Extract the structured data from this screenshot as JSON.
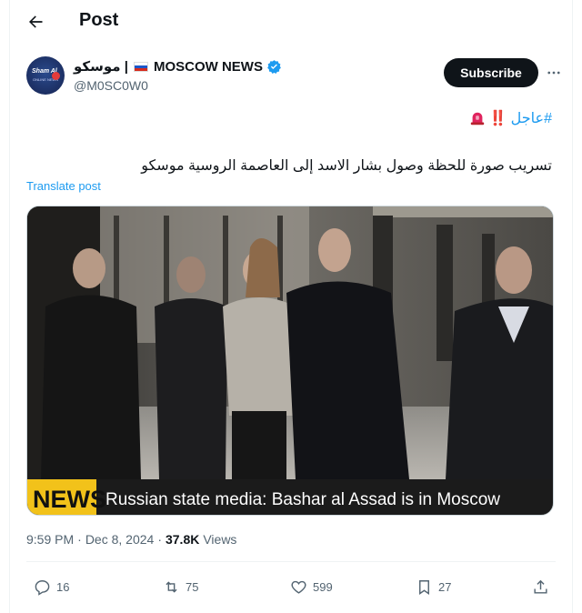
{
  "topbar": {
    "title": "Post"
  },
  "author": {
    "name_arabic": "موسكو |",
    "name_english": "MOSCOW NEWS",
    "handle": "@M0SC0W0",
    "avatar_text": "Sham Al",
    "avatar_sub": "ONLINE NEWS",
    "subscribe_label": "Subscribe"
  },
  "post": {
    "hashtag": "#عاجل",
    "bangs": "‼️",
    "text": "تسريب صورة للحظة وصول بشار الاسد إلى العاصمة الروسية موسكو",
    "translate_label": "Translate post"
  },
  "media": {
    "news_tag": "NEWS",
    "caption": "Russian state media: Bashar al Assad is in Moscow"
  },
  "meta": {
    "time": "9:59 PM",
    "separator1": "·",
    "date": "Dec 8, 2024",
    "separator2": "·",
    "views_count": "37.8K",
    "views_label": "Views"
  },
  "actions": {
    "replies": "16",
    "reposts": "75",
    "likes": "599",
    "bookmarks": "27"
  },
  "colors": {
    "accent": "#1d9bf0",
    "text": "#0f1419",
    "secondary": "#536471",
    "news_yellow": "#f2c21a"
  }
}
